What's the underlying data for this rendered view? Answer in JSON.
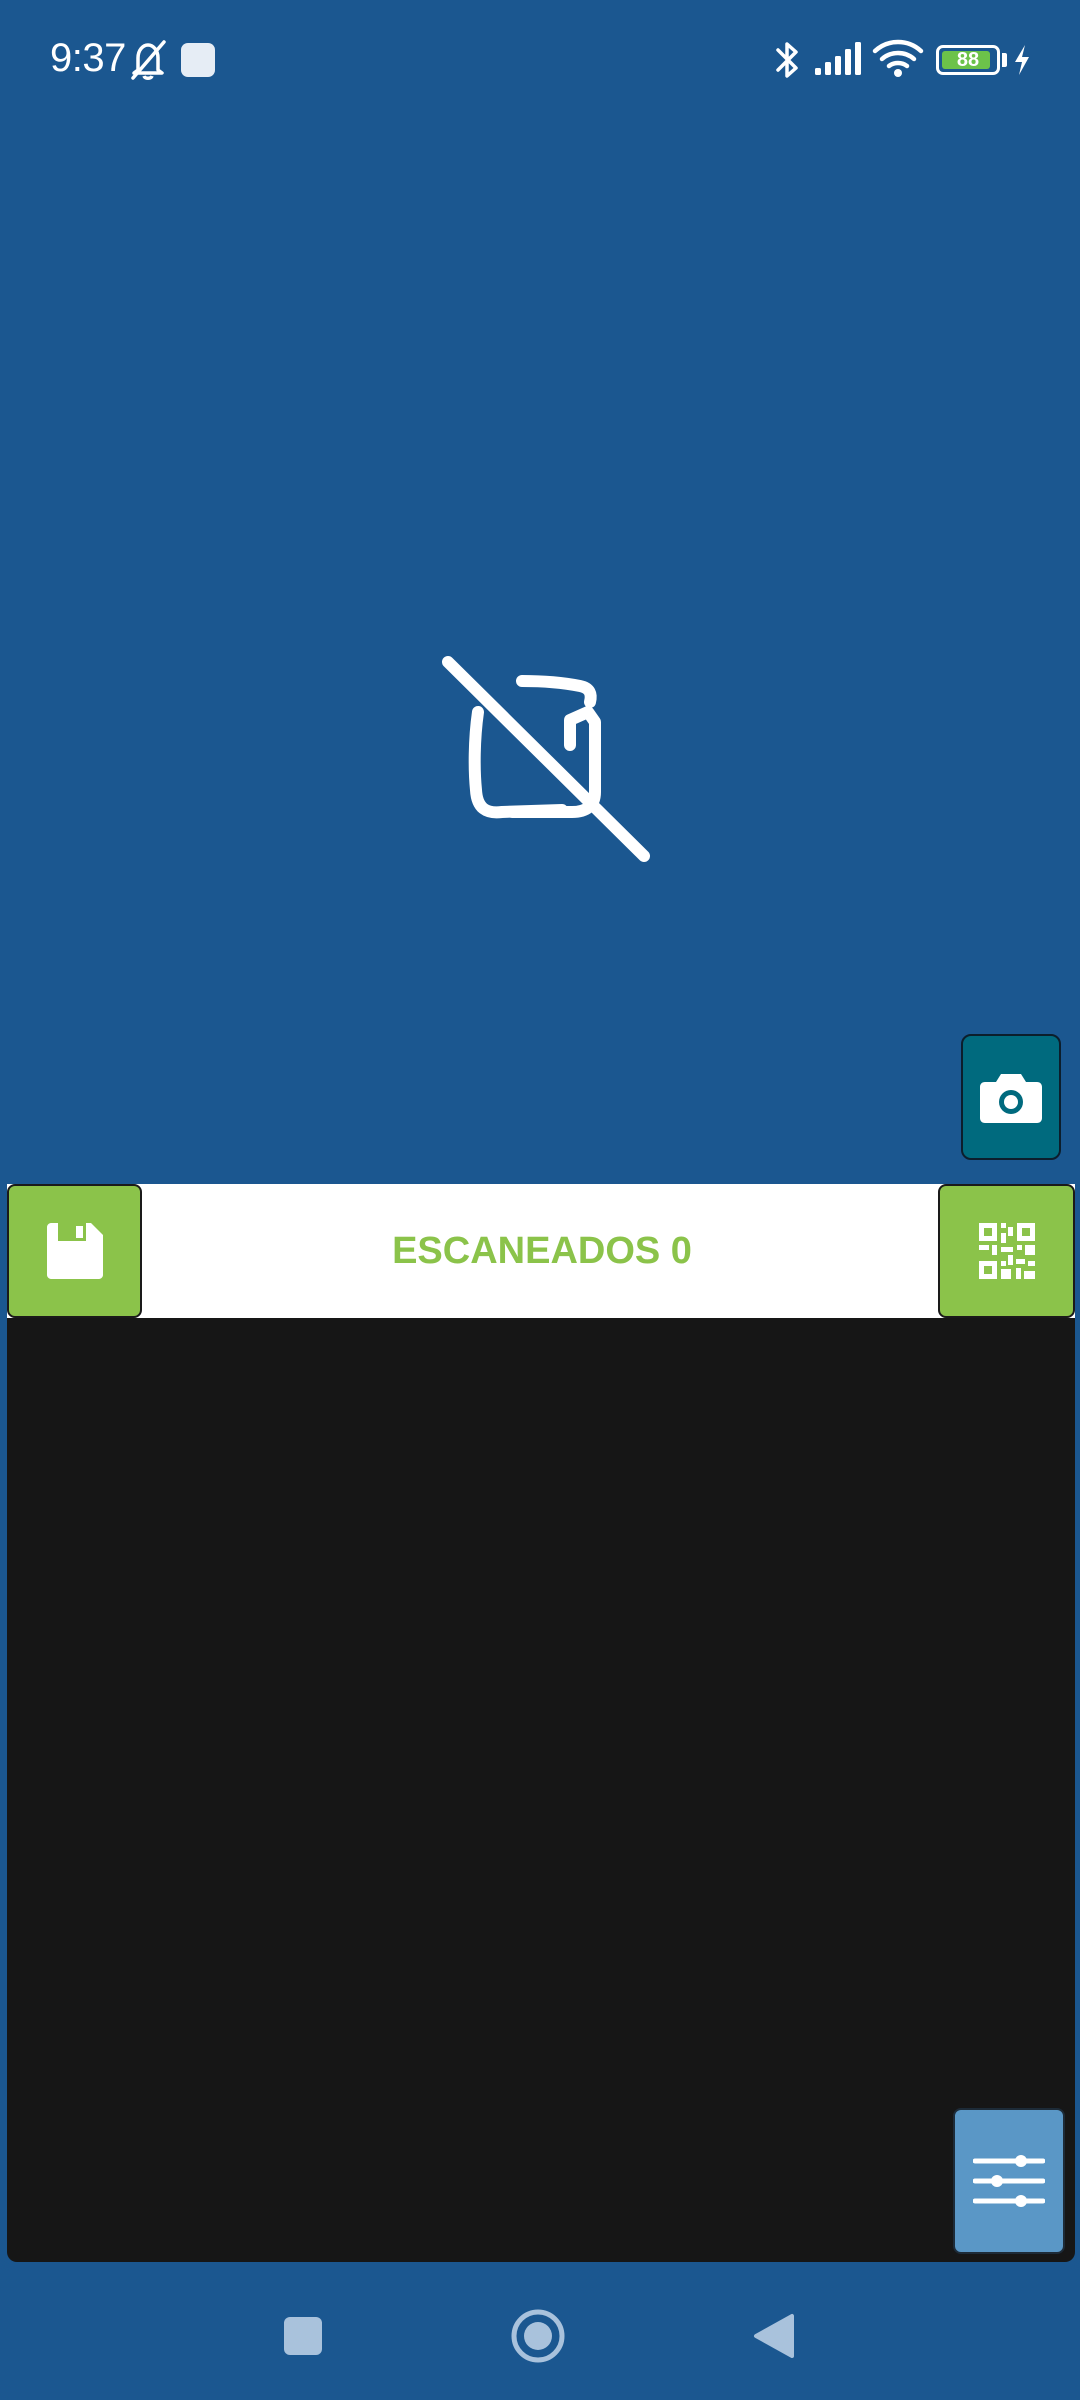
{
  "status_bar": {
    "time": "9:37",
    "battery_level": "88",
    "icons": [
      "bell-off-icon",
      "app-notification-icon",
      "bluetooth-icon",
      "signal-icon",
      "wifi-icon",
      "battery-icon",
      "charging-icon"
    ]
  },
  "camera": {
    "state_icon": "camera-off-icon",
    "capture_icon": "camera-icon"
  },
  "scanner": {
    "title": "ESCANEADOS 0",
    "save_icon": "floppy-disk-icon",
    "qr_icon": "qr-code-icon",
    "settings_icon": "sliders-icon"
  },
  "navigation": {
    "items": [
      "recents-button",
      "home-button",
      "back-button"
    ]
  },
  "colors": {
    "background": "#1b5790",
    "accent_green": "#8bc34a",
    "capture_teal": "#006a7e",
    "settings_blue": "#5a97c6",
    "list_dark": "#161616"
  }
}
